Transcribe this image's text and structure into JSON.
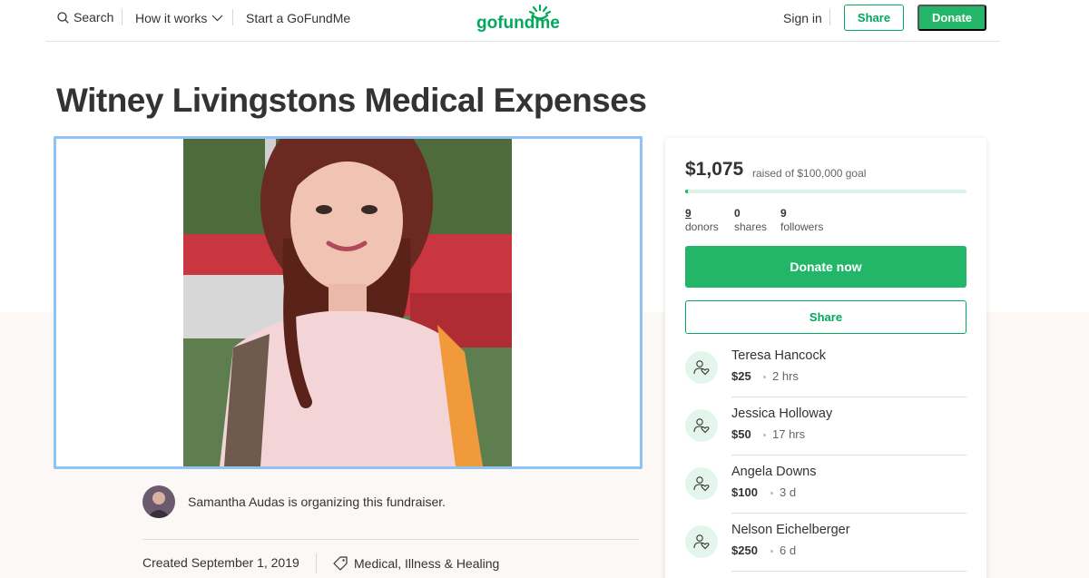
{
  "nav": {
    "search_label": "Search",
    "how_it_works_label": "How it works",
    "start_label": "Start a GoFundMe",
    "logo_text": "gofundme",
    "sign_in_label": "Sign in",
    "share_label": "Share",
    "donate_label": "Donate"
  },
  "campaign": {
    "title": "Witney Livingstons Medical Expenses",
    "organizer_text": "Samantha Audas is organizing this fundraiser.",
    "created": "Created September 1, 2019",
    "category": "Medical, Illness & Healing"
  },
  "sidebar": {
    "raised_amount": "$1,075",
    "raised_goal": "raised of $100,000 goal",
    "progress_fraction": 0.01075,
    "stats": [
      {
        "value": "9",
        "label": "donors"
      },
      {
        "value": "0",
        "label": "shares"
      },
      {
        "value": "9",
        "label": "followers"
      }
    ],
    "donate_now_label": "Donate now",
    "share_label": "Share",
    "donations": [
      {
        "name": "Teresa Hancock",
        "amount": "$25",
        "time": "2 hrs"
      },
      {
        "name": "Jessica Holloway",
        "amount": "$50",
        "time": "17 hrs"
      },
      {
        "name": "Angela Downs",
        "amount": "$100",
        "time": "3 d"
      },
      {
        "name": "Nelson Eichelberger",
        "amount": "$250",
        "time": "6 d"
      }
    ]
  },
  "colors": {
    "brand_green": "#02a95c",
    "button_green": "#23b568",
    "photo_border": "#8fc2f5"
  },
  "icons": [
    "search-icon",
    "chevron-down-icon",
    "tag-icon",
    "donor-heart-icon"
  ]
}
